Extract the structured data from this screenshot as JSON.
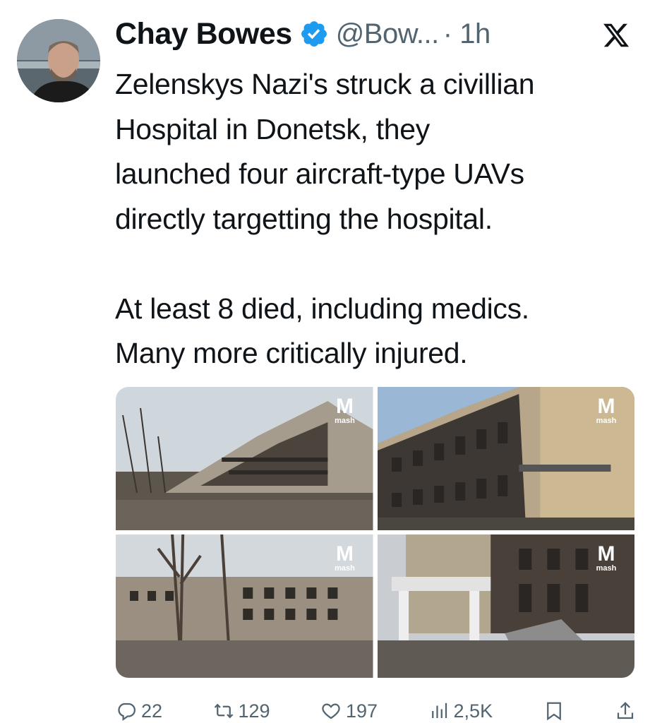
{
  "author": {
    "name": "Chay Bowes",
    "handle": "@Bow...",
    "time": "· 1h",
    "verified": true,
    "verified_color": "#1d9bf0"
  },
  "tweet": {
    "text": "Zelenskys Nazi's struck a  civillian\nHospital in Donetsk, they\nlaunched four aircraft-type UAVs\ndirectly targetting the hospital.\n\nAt least 8 died, including medics.\nMany more critically injured."
  },
  "media": {
    "watermark_letter": "M",
    "watermark_text": "mash",
    "images": [
      {
        "icon": "destroyed-building-photo"
      },
      {
        "icon": "burned-hospital-facade-photo"
      },
      {
        "icon": "ruined-building-trees-photo"
      },
      {
        "icon": "damaged-entrance-debris-photo"
      }
    ]
  },
  "actions": {
    "replies": "22",
    "reposts": "129",
    "likes": "197",
    "views": "2,5K"
  },
  "colors": {
    "text": "#0f1419",
    "secondary": "#536471",
    "accent": "#1d9bf0"
  }
}
